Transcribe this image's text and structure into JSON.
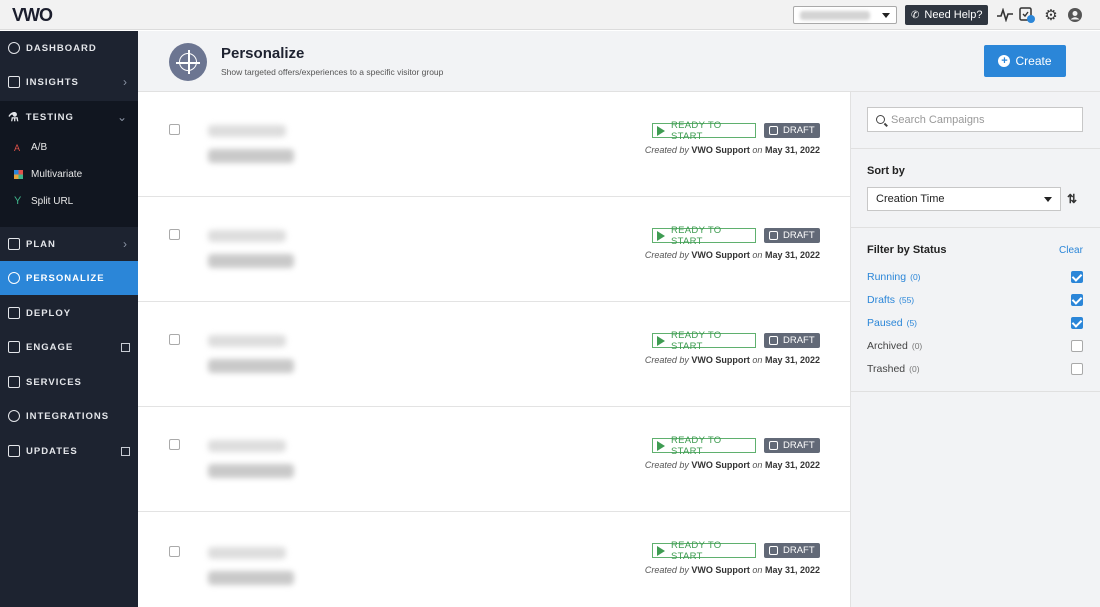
{
  "topbar": {
    "logo": "VWO",
    "help_label": "Need Help?",
    "icons": [
      "pulse-icon",
      "notification-icon",
      "gear-icon",
      "user-icon"
    ]
  },
  "sidebar": {
    "items": [
      {
        "label": "DASHBOARD",
        "icon": "dashboard-icon"
      },
      {
        "label": "INSIGHTS",
        "icon": "insights-icon"
      },
      {
        "label": "TESTING",
        "icon": "flask-icon"
      },
      {
        "label": "PLAN",
        "icon": "calendar-icon"
      },
      {
        "label": "PERSONALIZE",
        "icon": "target-icon"
      },
      {
        "label": "DEPLOY",
        "icon": "deploy-icon"
      },
      {
        "label": "ENGAGE",
        "icon": "engage-icon"
      },
      {
        "label": "SERVICES",
        "icon": "briefcase-icon"
      },
      {
        "label": "INTEGRATIONS",
        "icon": "plug-icon"
      },
      {
        "label": "UPDATES",
        "icon": "updates-icon"
      }
    ],
    "testing_sub": [
      {
        "label": "A/B",
        "color": "#e0524a"
      },
      {
        "label": "Multivariate",
        "color": "#e8a33a"
      },
      {
        "label": "Split URL",
        "color": "#3fb58b"
      }
    ]
  },
  "header": {
    "title": "Personalize",
    "subtitle": "Show targeted offers/experiences to a specific visitor group",
    "create_label": "Create"
  },
  "campaigns": [
    {
      "status": "READY TO START",
      "state": "DRAFT",
      "created_prefix": "Created by",
      "author": "VWO Support",
      "on": "on",
      "date": "May 31, 2022"
    },
    {
      "status": "READY TO START",
      "state": "DRAFT",
      "created_prefix": "Created by",
      "author": "VWO Support",
      "on": "on",
      "date": "May 31, 2022"
    },
    {
      "status": "READY TO START",
      "state": "DRAFT",
      "created_prefix": "Created by",
      "author": "VWO Support",
      "on": "on",
      "date": "May 31, 2022"
    },
    {
      "status": "READY TO START",
      "state": "DRAFT",
      "created_prefix": "Created by",
      "author": "VWO Support",
      "on": "on",
      "date": "May 31, 2022"
    },
    {
      "status": "READY TO START",
      "state": "DRAFT",
      "created_prefix": "Created by",
      "author": "VWO Support",
      "on": "on",
      "date": "May 31, 2022"
    }
  ],
  "panel": {
    "search_placeholder": "Search Campaigns",
    "sort_label": "Sort by",
    "sort_value": "Creation Time",
    "filter_label": "Filter by Status",
    "clear_label": "Clear",
    "filters": [
      {
        "label": "Running",
        "count": "(0)",
        "checked": true
      },
      {
        "label": "Drafts",
        "count": "(55)",
        "checked": true
      },
      {
        "label": "Paused",
        "count": "(5)",
        "checked": true
      },
      {
        "label": "Archived",
        "count": "(0)",
        "checked": false
      },
      {
        "label": "Trashed",
        "count": "(0)",
        "checked": false
      }
    ]
  },
  "colors": {
    "accent": "#2b86d8",
    "sidebar_bg": "#1d2330",
    "ready_green": "#3f9c52",
    "draft_gray": "#626977"
  }
}
